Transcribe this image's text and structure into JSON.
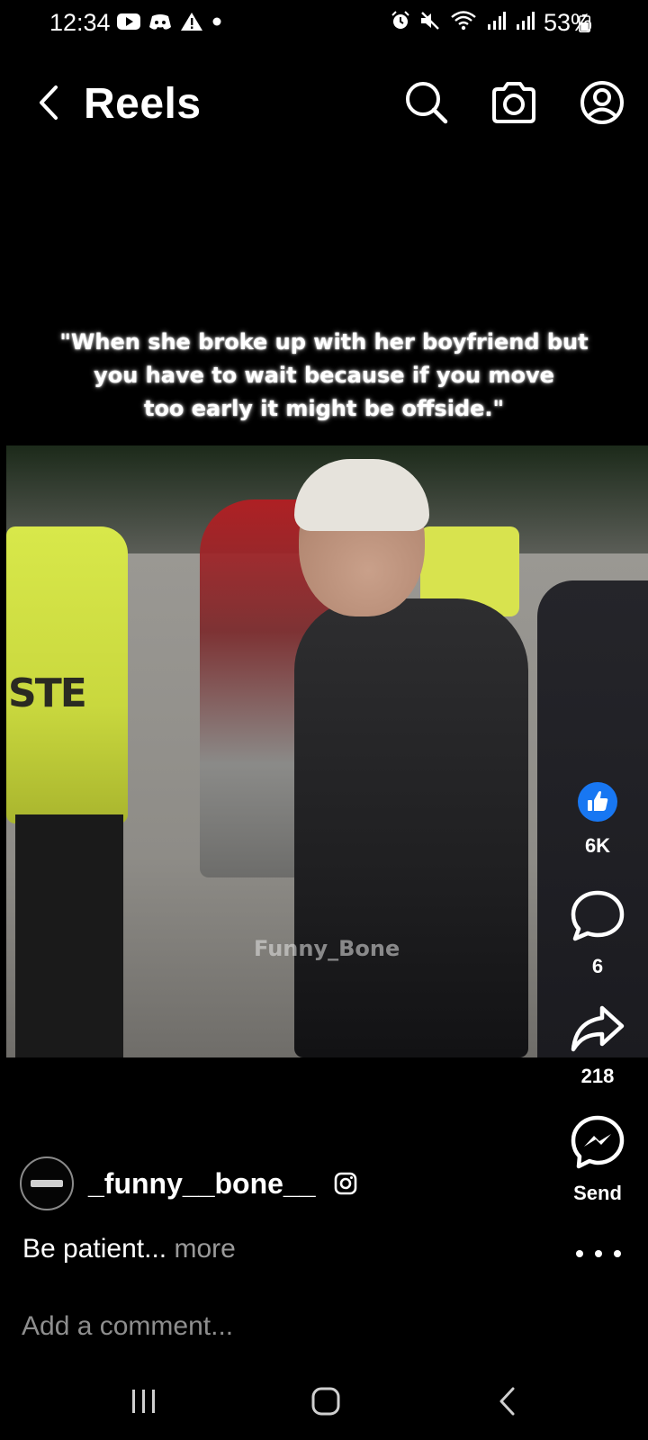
{
  "status_bar": {
    "time": "12:34",
    "left_icons": [
      "youtube-icon",
      "discord-icon",
      "warning-icon",
      "dot-icon"
    ],
    "right_icons": [
      "alarm-icon",
      "mute-icon",
      "wifi-icon",
      "signal-icon",
      "signal-icon"
    ],
    "battery": "53%"
  },
  "header": {
    "title": "Reels",
    "icons": [
      "back-icon",
      "search-icon",
      "camera-icon",
      "profile-icon"
    ]
  },
  "video": {
    "caption_lines": [
      "\"When she broke up with her boyfriend but",
      "you have to wait because if you move",
      "too early it might be offside.\""
    ],
    "watermark": "Funny_Bone"
  },
  "actions": {
    "like_count": "6K",
    "comment_count": "6",
    "share_count": "218",
    "send_label": "Send",
    "like_color": "#1877F2"
  },
  "post": {
    "author": "_funny__bone__",
    "caption": "Be patient...",
    "more_label": "more"
  },
  "comment": {
    "placeholder": "Add a comment..."
  },
  "nav": {
    "buttons": [
      "recent-apps-icon",
      "home-icon",
      "back-icon"
    ]
  }
}
